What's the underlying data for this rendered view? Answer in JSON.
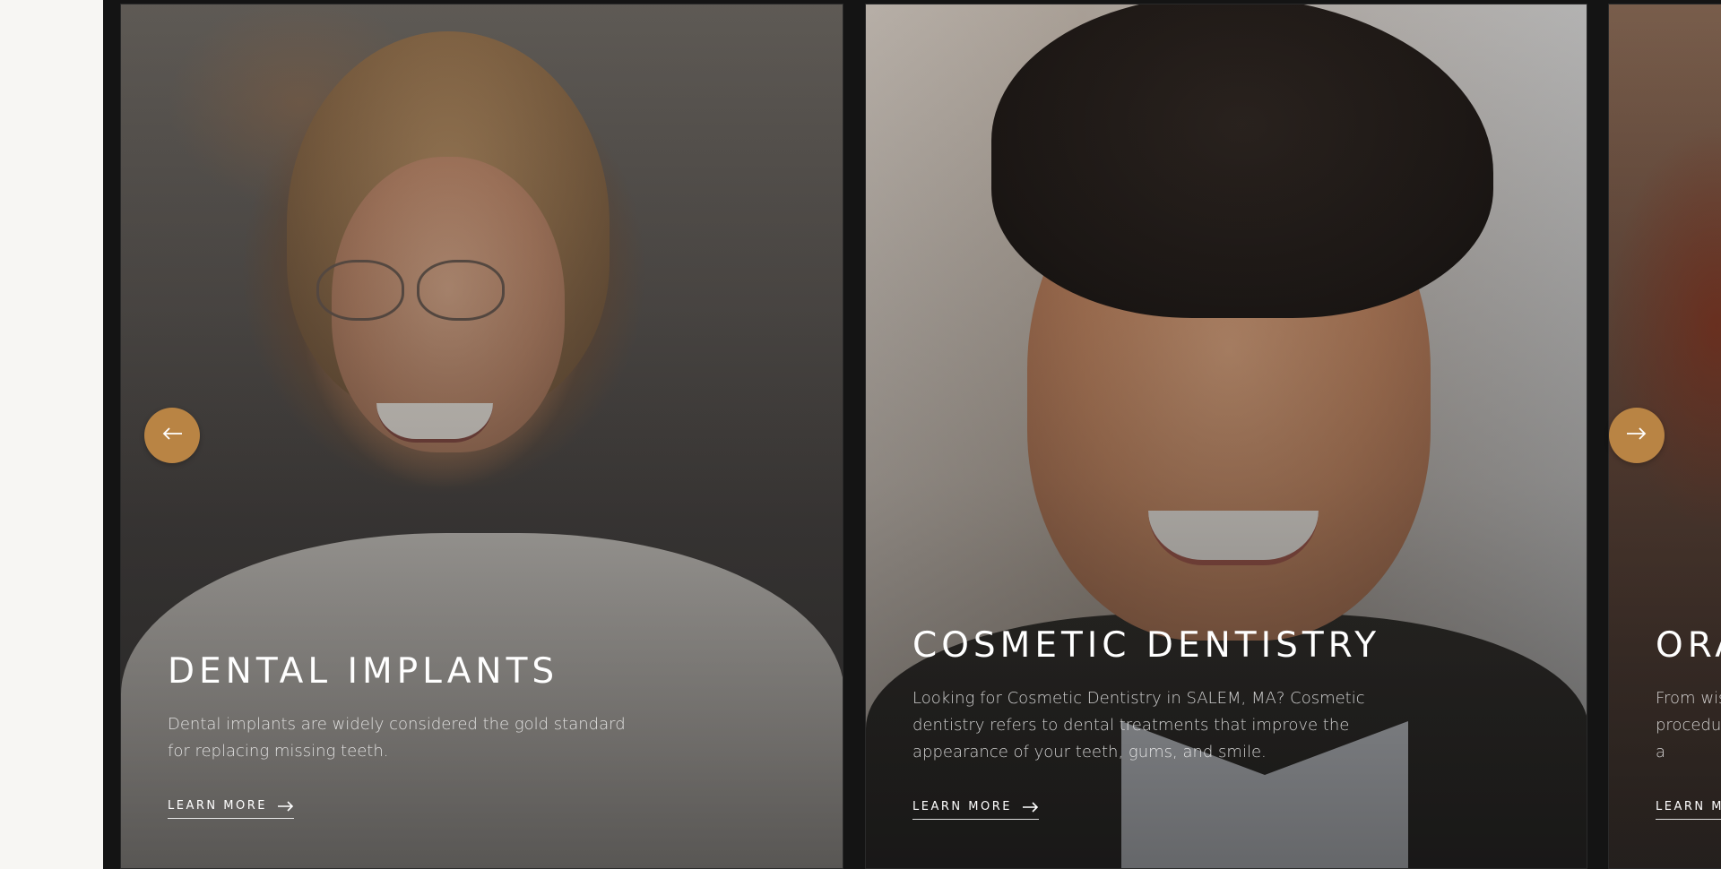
{
  "carousel": {
    "prev_icon": "arrow-left-icon",
    "next_icon": "arrow-right-icon",
    "accent_color": "#b98444",
    "cards": [
      {
        "title": "DENTAL IMPLANTS",
        "description": "Dental implants are widely considered the gold standard for replacing missing teeth.",
        "link_label": "LEARN MORE"
      },
      {
        "title": "COSMETIC DENTISTRY",
        "description": "Looking for Cosmetic Dentistry in SALEM, MA? Cosmetic dentistry refers to dental treatments that improve the appearance of your teeth, gums, and smile.",
        "link_label": "LEARN MORE"
      },
      {
        "title": "ORA",
        "description": "From wis procedu comfort a",
        "link_label": "LEARN M"
      }
    ]
  }
}
